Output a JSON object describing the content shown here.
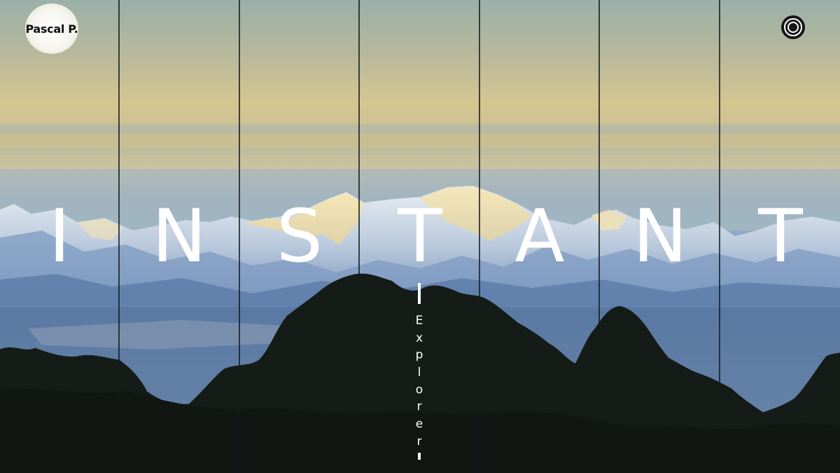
{
  "brand": {
    "logo_text": "Pascal P."
  },
  "menu": {
    "icon": "concentric-circles-icon"
  },
  "hero": {
    "title_letters": [
      "I",
      "N",
      "S",
      "T",
      "A",
      "N",
      "T"
    ]
  },
  "explore": {
    "letters": [
      "E",
      "x",
      "p",
      "l",
      "o",
      "r",
      "e",
      "r"
    ]
  },
  "colors": {
    "text": "#ffffff",
    "logo_bg": "#f6f5ee",
    "divider": "#14181e",
    "sky_top": "#9fb1a8",
    "sky_glow": "#d8c690",
    "mountain_blue": "#5d7fa8",
    "tree_dark": "#161c18"
  }
}
